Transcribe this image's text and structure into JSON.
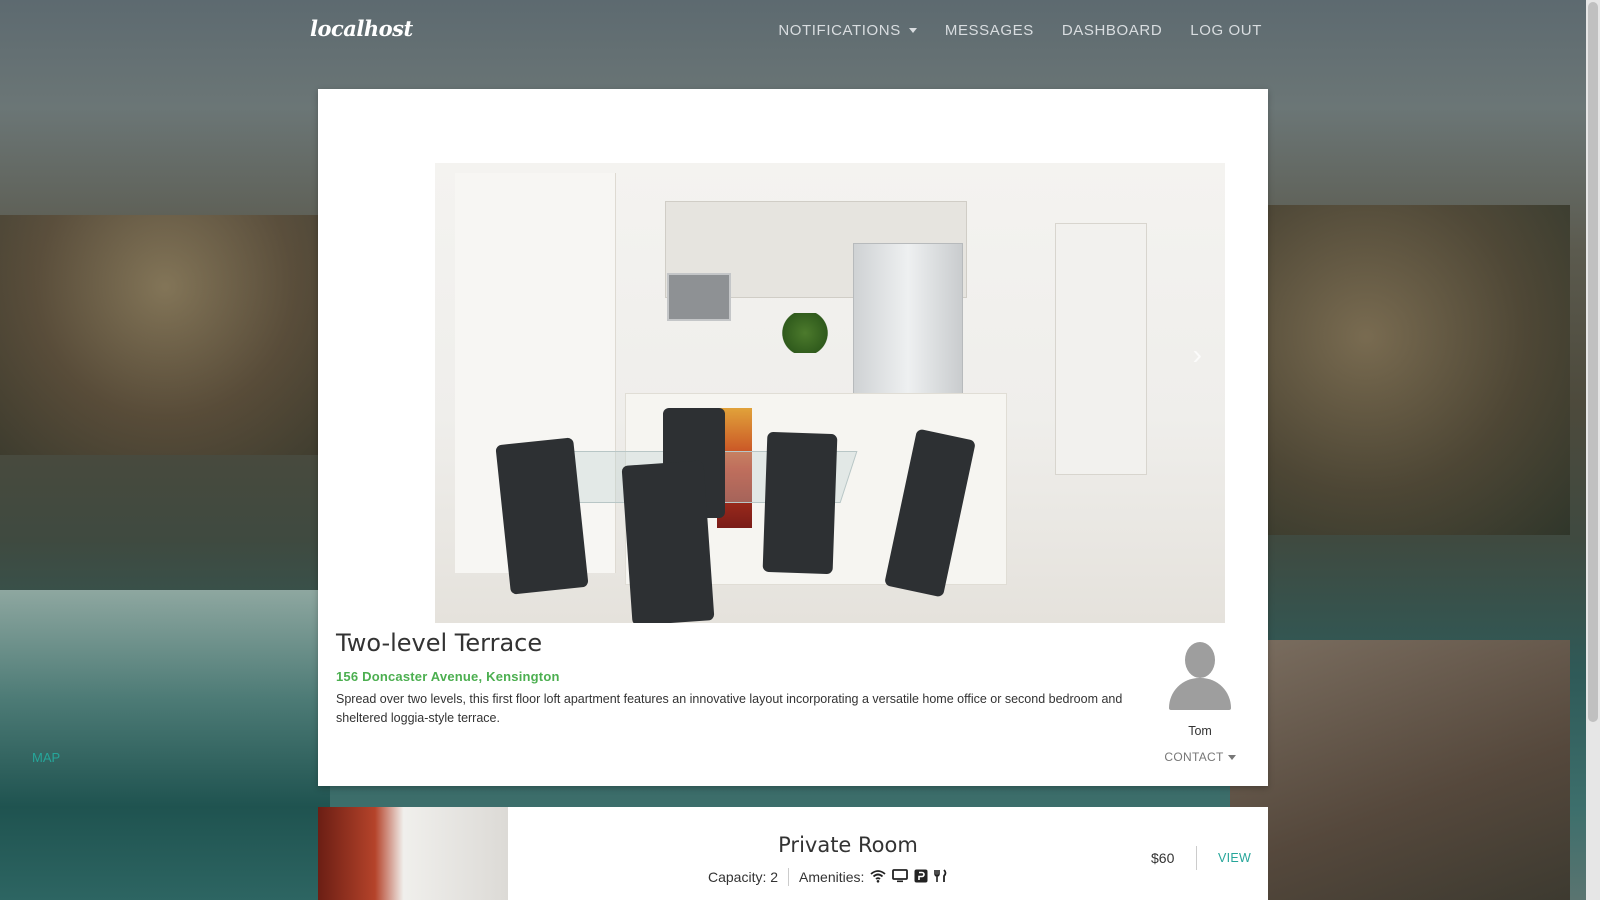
{
  "nav": {
    "brand": "localhost",
    "links": [
      {
        "label": "NOTIFICATIONS",
        "dropdown": true
      },
      {
        "label": "MESSAGES"
      },
      {
        "label": "DASHBOARD"
      },
      {
        "label": "LOG OUT"
      }
    ]
  },
  "listing": {
    "title": "Two-level Terrace",
    "address": "156 Doncaster Avenue, Kensington",
    "description": "Spread over two levels, this first floor loft apartment features an innovative layout incorporating a versatile home office or second bedroom and sheltered loggia-style terrace.",
    "map_label": "MAP",
    "carousel_next_icon": "chevron-right-icon"
  },
  "host": {
    "name": "Tom",
    "contact_label": "CONTACT",
    "avatar_icon": "user-silhouette-icon"
  },
  "rooms": [
    {
      "title": "Private Room",
      "capacity_label": "Capacity: 2",
      "amenities_label": "Amenities:",
      "amenity_icons": [
        "wifi-icon",
        "tv-icon",
        "parking-icon",
        "dining-icon"
      ],
      "price": "$60",
      "view_label": "VIEW"
    }
  ],
  "colors": {
    "accent": "#26a69a",
    "address": "#4caf50"
  }
}
